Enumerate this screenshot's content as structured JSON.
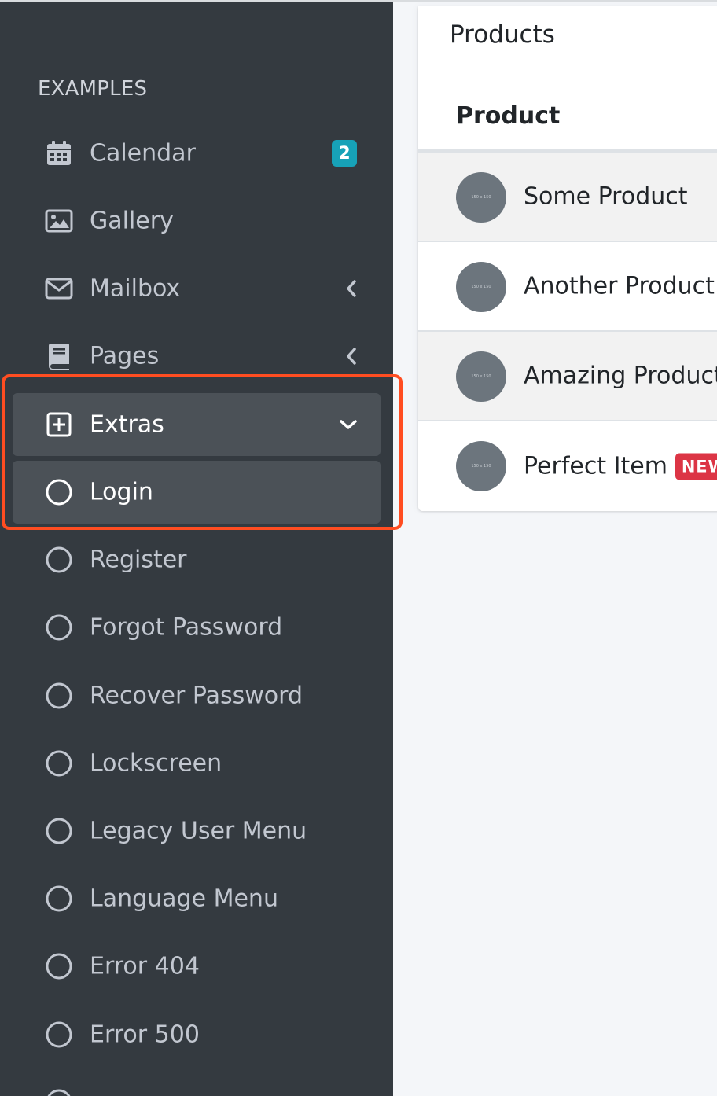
{
  "sidebar": {
    "header": "EXAMPLES",
    "items": [
      {
        "label": "Calendar",
        "icon": "calendar-icon",
        "badge": "2"
      },
      {
        "label": "Gallery",
        "icon": "image-icon"
      },
      {
        "label": "Mailbox",
        "icon": "envelope-icon",
        "arrow": "chevron-left-icon"
      },
      {
        "label": "Pages",
        "icon": "book-icon",
        "arrow": "chevron-left-icon"
      },
      {
        "label": "Extras",
        "icon": "plus-square-icon",
        "arrow": "chevron-down-icon",
        "open": true
      },
      {
        "label": "Login",
        "icon": "circle-icon",
        "active": true
      },
      {
        "label": "Register",
        "icon": "circle-icon"
      },
      {
        "label": "Forgot Password",
        "icon": "circle-icon"
      },
      {
        "label": "Recover Password",
        "icon": "circle-icon"
      },
      {
        "label": "Lockscreen",
        "icon": "circle-icon"
      },
      {
        "label": "Legacy User Menu",
        "icon": "circle-icon"
      },
      {
        "label": "Language Menu",
        "icon": "circle-icon"
      },
      {
        "label": "Error 404",
        "icon": "circle-icon"
      },
      {
        "label": "Error 500",
        "icon": "circle-icon"
      }
    ]
  },
  "main": {
    "card": {
      "title": "Products",
      "table": {
        "header": "Product",
        "placeholder_text": "150 x 150",
        "rows": [
          {
            "name": "Some Product"
          },
          {
            "name": "Another Product"
          },
          {
            "name": "Amazing Product"
          },
          {
            "name": "Perfect Item",
            "badge": "NEW"
          }
        ]
      }
    }
  },
  "colors": {
    "sidebar_bg": "#343a40",
    "sidebar_text": "#c2c7d0",
    "active_bg": "#4b5157",
    "badge_info": "#17a2b8",
    "badge_new": "#dc3545",
    "highlight": "#ff4d21",
    "content_bg": "#f4f6f9"
  }
}
